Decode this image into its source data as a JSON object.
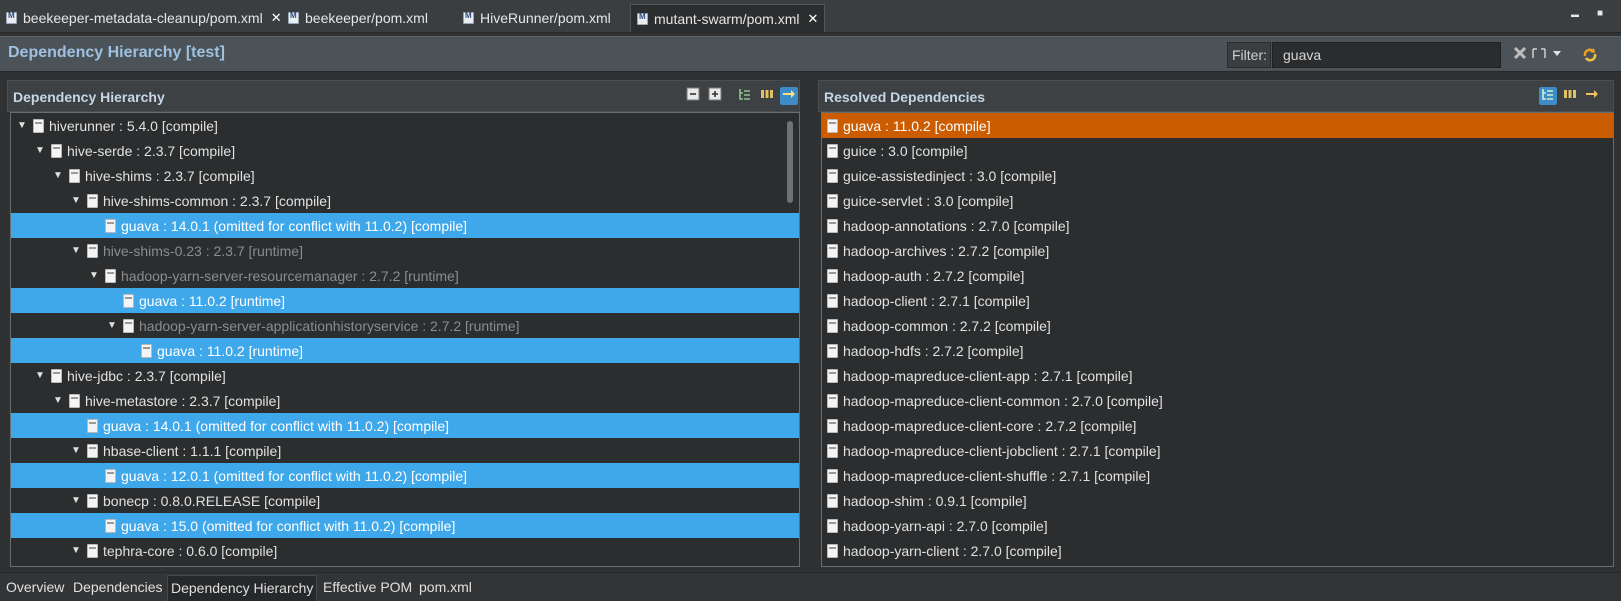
{
  "editor_tabs": [
    {
      "label": "beekeeper-metadata-cleanup/pom.xml",
      "close": "✕"
    },
    {
      "label": "beekeeper/pom.xml"
    },
    {
      "label": "HiveRunner/pom.xml"
    },
    {
      "label": "mutant-swarm/pom.xml",
      "close": "✕"
    }
  ],
  "window": {
    "minimize": "▬",
    "maximize": "■"
  },
  "header": {
    "title": "Dependency Hierarchy [test]",
    "filter_label": "Filter:",
    "filter_value": "guava"
  },
  "left_panel": {
    "title": "Dependency Hierarchy",
    "rows": [
      {
        "text": "hiverunner : 5.4.0 [compile]",
        "toggle": "▼"
      },
      {
        "text": "hive-serde : 2.3.7 [compile]",
        "toggle": "▼"
      },
      {
        "text": "hive-shims : 2.3.7 [compile]",
        "toggle": "▼"
      },
      {
        "text": "hive-shims-common : 2.3.7 [compile]",
        "toggle": "▼"
      },
      {
        "text": "guava : 14.0.1 (omitted for conflict with 11.0.2) [compile]",
        "toggle": ""
      },
      {
        "text": "hive-shims-0.23 : 2.3.7 [runtime]",
        "toggle": "▼"
      },
      {
        "text": "hadoop-yarn-server-resourcemanager : 2.7.2 [runtime]",
        "toggle": "▼"
      },
      {
        "text": "guava : 11.0.2 [runtime]",
        "toggle": ""
      },
      {
        "text": "hadoop-yarn-server-applicationhistoryservice : 2.7.2 [runtime]",
        "toggle": "▼"
      },
      {
        "text": "guava : 11.0.2 [runtime]",
        "toggle": ""
      },
      {
        "text": "hive-jdbc : 2.3.7 [compile]",
        "toggle": "▼"
      },
      {
        "text": "hive-metastore : 2.3.7 [compile]",
        "toggle": "▼"
      },
      {
        "text": "guava : 14.0.1 (omitted for conflict with 11.0.2) [compile]",
        "toggle": ""
      },
      {
        "text": "hbase-client : 1.1.1 [compile]",
        "toggle": "▼"
      },
      {
        "text": "guava : 12.0.1 (omitted for conflict with 11.0.2) [compile]",
        "toggle": ""
      },
      {
        "text": "bonecp : 0.8.0.RELEASE [compile]",
        "toggle": "▼"
      },
      {
        "text": "guava : 15.0 (omitted for conflict with 11.0.2) [compile]",
        "toggle": ""
      },
      {
        "text": "tephra-core : 0.6.0 [compile]",
        "toggle": "▼"
      }
    ]
  },
  "right_panel": {
    "title": "Resolved Dependencies",
    "rows": [
      "guava : 11.0.2 [compile]",
      "guice : 3.0 [compile]",
      "guice-assistedinject : 3.0 [compile]",
      "guice-servlet : 3.0 [compile]",
      "hadoop-annotations : 2.7.0 [compile]",
      "hadoop-archives : 2.7.2 [compile]",
      "hadoop-auth : 2.7.2 [compile]",
      "hadoop-client : 2.7.1 [compile]",
      "hadoop-common : 2.7.2 [compile]",
      "hadoop-hdfs : 2.7.2 [compile]",
      "hadoop-mapreduce-client-app : 2.7.1 [compile]",
      "hadoop-mapreduce-client-common : 2.7.0 [compile]",
      "hadoop-mapreduce-client-core : 2.7.2 [compile]",
      "hadoop-mapreduce-client-jobclient : 2.7.1 [compile]",
      "hadoop-mapreduce-client-shuffle : 2.7.1 [compile]",
      "hadoop-shim : 0.9.1 [compile]",
      "hadoop-yarn-api : 2.7.0 [compile]",
      "hadoop-yarn-client : 2.7.0 [compile]"
    ]
  },
  "bottom_tabs": [
    "Overview",
    "Dependencies",
    "Dependency Hierarchy",
    "Effective POM",
    "pom.xml"
  ],
  "colors": {
    "highlight": "#3fa8ea",
    "selected": "#cc5c00",
    "title": "#9fc0e0"
  }
}
